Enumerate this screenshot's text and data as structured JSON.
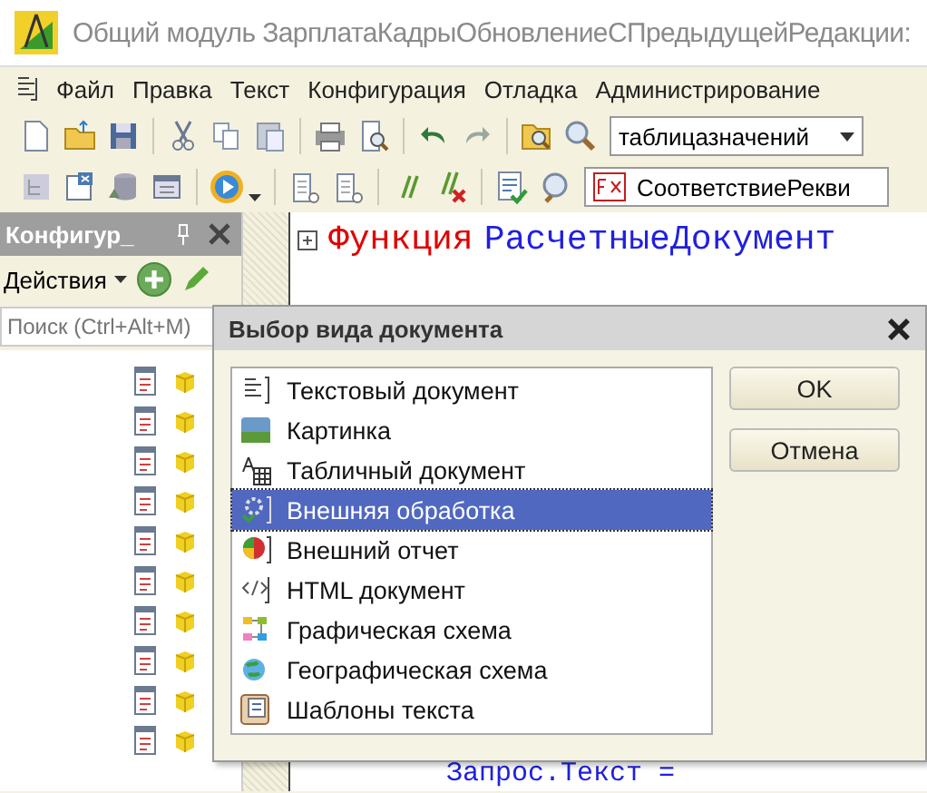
{
  "window": {
    "title": "Общий модуль ЗарплатаКадрыОбновлениеСПредыдущейРедакции:"
  },
  "menu": [
    {
      "label": "Файл"
    },
    {
      "label": "Правка"
    },
    {
      "label": "Текст"
    },
    {
      "label": "Конфигурация"
    },
    {
      "label": "Отладка"
    },
    {
      "label": "Администрирование"
    }
  ],
  "toolbar": {
    "search_value": "таблицазначений",
    "method_value": "СоответствиеРекви"
  },
  "panel": {
    "title": "Конфигур_",
    "actions_label": "Действия",
    "search_placeholder": "Поиск (Ctrl+Alt+M)",
    "rows": [
      {
        "kind": "module"
      },
      {
        "kind": "module"
      },
      {
        "kind": "module"
      },
      {
        "kind": "module"
      },
      {
        "kind": "module"
      },
      {
        "kind": "module"
      },
      {
        "kind": "module"
      },
      {
        "kind": "module"
      },
      {
        "kind": "module"
      },
      {
        "kind": "module"
      }
    ]
  },
  "code": [
    {
      "kind": "function_header",
      "keyword": "Функция",
      "name": "РасчетныеДокумент"
    },
    {
      "kind": "statement",
      "text": "Запрос.Текст ="
    }
  ],
  "dialog": {
    "title": "Выбор вида документа",
    "items": [
      {
        "kind": "text",
        "label": "Текстовый документ",
        "selected": false
      },
      {
        "kind": "picture",
        "label": "Картинка",
        "selected": false
      },
      {
        "kind": "spreadsheet",
        "label": "Табличный документ",
        "selected": false
      },
      {
        "kind": "processing",
        "label": "Внешняя обработка",
        "selected": true
      },
      {
        "kind": "report",
        "label": "Внешний отчет",
        "selected": false
      },
      {
        "kind": "html",
        "label": "HTML документ",
        "selected": false
      },
      {
        "kind": "graphic",
        "label": "Графическая схема",
        "selected": false
      },
      {
        "kind": "geo",
        "label": "Географическая схема",
        "selected": false
      },
      {
        "kind": "template",
        "label": "Шаблоны текста",
        "selected": false
      }
    ],
    "buttons": [
      {
        "label": "OK"
      },
      {
        "label": "Отмена"
      }
    ]
  }
}
